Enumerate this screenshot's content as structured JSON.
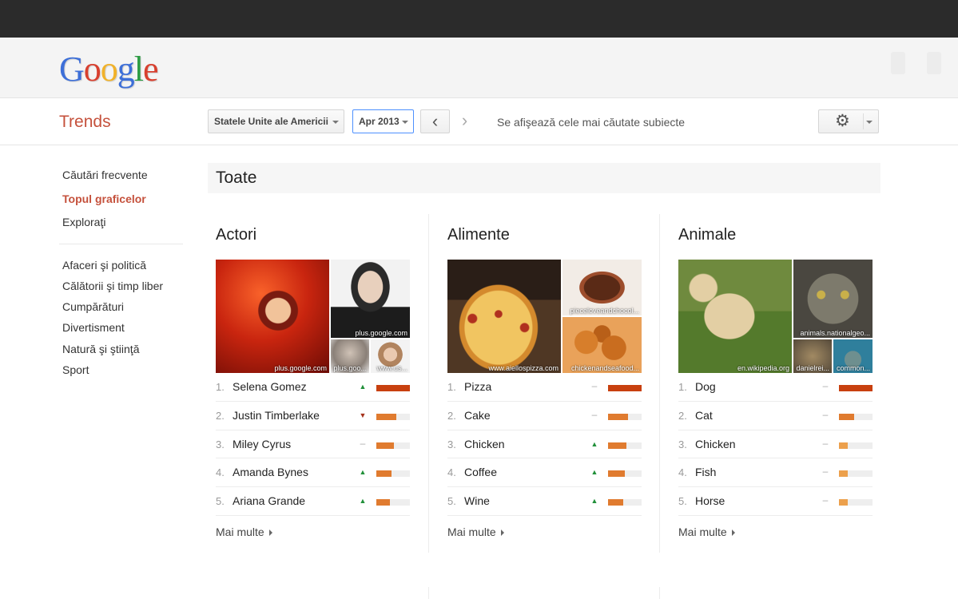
{
  "header": {
    "logo_letters": [
      {
        "ch": "G",
        "color": "#3d6fd8"
      },
      {
        "ch": "o",
        "color": "#d8402f"
      },
      {
        "ch": "o",
        "color": "#f1b22a"
      },
      {
        "ch": "g",
        "color": "#3d6fd8"
      },
      {
        "ch": "l",
        "color": "#2c9c43"
      },
      {
        "ch": "e",
        "color": "#d8402f"
      }
    ]
  },
  "toolbar": {
    "title": "Trends",
    "region": "Statele Unite ale Americii",
    "month": "Apr 2013",
    "prev_icon": "‹",
    "next_icon": "›",
    "showing_text": "Se afişează cele mai căutate subiecte",
    "gear_icon": "⚙"
  },
  "sidebar": {
    "primary": [
      {
        "label": "Căutări frecvente",
        "active": false
      },
      {
        "label": "Topul graficelor",
        "active": true
      },
      {
        "label": "Exploraţi",
        "active": false
      }
    ],
    "categories": [
      "Afaceri şi politică",
      "Călătorii şi timp liber",
      "Cumpărături",
      "Divertisment",
      "Natură şi ştiinţă",
      "Sport"
    ]
  },
  "section_title": "Toate",
  "colors": {
    "accent": "#c5513c",
    "bar_top": "#c8400f",
    "bar_other": "#e07b2f",
    "bar_light": "#eca04c"
  },
  "columns": [
    {
      "title": "Actori",
      "captions": [
        "plus.google.com",
        "plus.google.com",
        "plus.goo...",
        "www.us..."
      ],
      "items": [
        {
          "rank": "1.",
          "name": "Selena Gomez",
          "trend": "up",
          "value": 100
        },
        {
          "rank": "2.",
          "name": "Justin Timberlake",
          "trend": "down",
          "value": 60
        },
        {
          "rank": "3.",
          "name": "Miley Cyrus",
          "trend": "flat",
          "value": 52
        },
        {
          "rank": "4.",
          "name": "Amanda Bynes",
          "trend": "up",
          "value": 45
        },
        {
          "rank": "5.",
          "name": "Ariana Grande",
          "trend": "up",
          "value": 40
        }
      ],
      "more": "Mai multe"
    },
    {
      "title": "Alimente",
      "captions": [
        "www.aiellospizza.com",
        "pieceloveandchocol...",
        "chickenandseafood..."
      ],
      "items": [
        {
          "rank": "1.",
          "name": "Pizza",
          "trend": "flat",
          "value": 100
        },
        {
          "rank": "2.",
          "name": "Cake",
          "trend": "flat",
          "value": 60
        },
        {
          "rank": "3.",
          "name": "Chicken",
          "trend": "up",
          "value": 55
        },
        {
          "rank": "4.",
          "name": "Coffee",
          "trend": "up",
          "value": 50
        },
        {
          "rank": "5.",
          "name": "Wine",
          "trend": "up",
          "value": 45
        }
      ],
      "more": "Mai multe"
    },
    {
      "title": "Animale",
      "captions": [
        "en.wikipedia.org",
        "animals.nationalgeo...",
        "danielrei...",
        "common..."
      ],
      "items": [
        {
          "rank": "1.",
          "name": "Dog",
          "trend": "flat",
          "value": 100
        },
        {
          "rank": "2.",
          "name": "Cat",
          "trend": "flat",
          "value": 45
        },
        {
          "rank": "3.",
          "name": "Chicken",
          "trend": "flat",
          "value": 25
        },
        {
          "rank": "4.",
          "name": "Fish",
          "trend": "flat",
          "value": 25
        },
        {
          "rank": "5.",
          "name": "Horse",
          "trend": "flat",
          "value": 25
        }
      ],
      "more": "Mai multe"
    }
  ]
}
